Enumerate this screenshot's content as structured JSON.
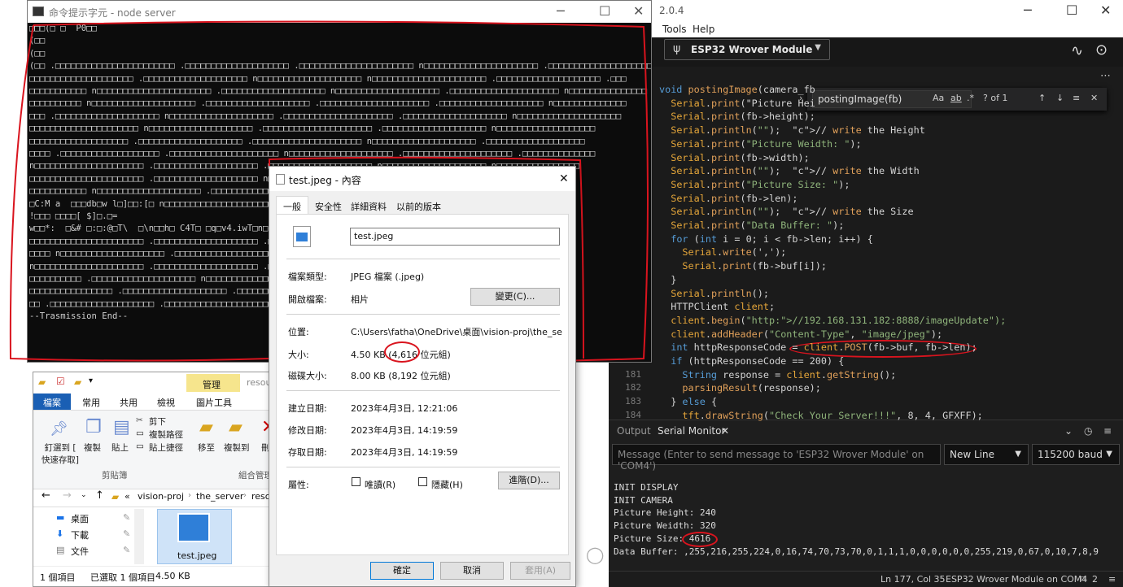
{
  "ide": {
    "title": "2.0.4",
    "menu": [
      "Tools",
      "Help"
    ],
    "board": "ESP32 Wrover Module",
    "find": {
      "query": "postingImage(fb)",
      "aa": "Aa",
      "ab": "ab",
      "star": ".*",
      "count": "? of 1"
    },
    "code": [
      "void postingImage(camera_fb",
      "  Serial.print(\"Picture Hei",
      "  Serial.print(fb->height);",
      "  Serial.println(\"\");  // write the Height",
      "  Serial.print(\"Picture Weidth: \");",
      "  Serial.print(fb->width);",
      "  Serial.println(\"\");  // write the Width",
      "  Serial.print(\"Picture Size: \");",
      "  Serial.print(fb->len);",
      "  Serial.println(\"\");  // write the Size",
      "  Serial.print(\"Data Buffer: \");",
      "  for (int i = 0; i < fb->len; i++) {",
      "    Serial.write(',');",
      "    Serial.print(fb->buf[i]);",
      "  }",
      "  Serial.println();",
      "  HTTPClient client;",
      "  client.begin(\"http://192.168.131.182:8888/imageUpdate\");",
      "  client.addHeader(\"Content-Type\", \"image/jpeg\");",
      "  int httpResponseCode = client.POST(fb->buf, fb->len);",
      "  if (httpResponseCode == 200) {",
      "    String response = client.getString();",
      "    parsingResult(response);",
      "  } else {",
      "    tft.drawString(\"Check Your Server!!!\", 8, 4, GFXFF);"
    ],
    "line_numbers": [
      "181",
      "182",
      "183",
      "184"
    ],
    "tabs": {
      "output": "Output",
      "serial": "Serial Monitor"
    },
    "message_placeholder": "Message (Enter to send message to 'ESP32 Wrover Module' on 'COM4')",
    "line_ending": "New Line",
    "baud": "115200 baud",
    "serial_lines": [
      "INIT DISPLAY",
      "INIT CAMERA",
      "Picture Height: 240",
      "Picture Weidth: 320",
      "Picture Size: 4616",
      "Data Buffer: ,255,216,255,224,0,16,74,70,73,70,0,1,1,1,0,0,0,0,0,0,255,219,0,67,0,10,7,8,9"
    ],
    "status": {
      "pos": "Ln 177, Col 35",
      "board": "ESP32 Wrover Module on COM4",
      "count": "2"
    }
  },
  "cmd": {
    "title": "命令提示字元 - node  server",
    "lines": [
      "\u0000\u0000\u0000(\u0000 \u0000  P0\u0000\u0000",
      "(\u0000\u0000",
      "(\u0000\u0000",
      "(\u0000\u0000 .\u0000\u0000\u0000\u0000\u0000\u0000\u0000\u0000\u0000\u0000\u0000\u0000\u0000\u0000\u0000\u0000\u0000\u0000\u0000\u0000\u0000\u0000\u0000 .\u0000\u0000\u0000\u0000\u0000\u0000\u0000\u0000\u0000\u0000\u0000\u0000\u0000\u0000\u0000\u0000\u0000\u0000\u0000\u0000 .\u0000\u0000\u0000\u0000\u0000\u0000\u0000\u0000\u0000\u0000\u0000\u0000\u0000\u0000\u0000\u0000\u0000\u0000\u0000\u0000\u0000\u0000 n\u0000\u0000\u0000\u0000\u0000\u0000\u0000\u0000\u0000\u0000\u0000\u0000\u0000\u0000\u0000\u0000\u0000\u0000\u0000\u0000\u0000\u0000 .\u0000\u0000\u0000\u0000\u0000\u0000\u0000\u0000\u0000\u0000\u0000\u0000\u0000\u0000\u0000\u0000\u0000\u0000\u0000\u0000",
      "\u0000\u0000\u0000\u0000\u0000\u0000\u0000\u0000\u0000\u0000\u0000\u0000\u0000\u0000\u0000\u0000\u0000\u0000\u0000\u0000 .\u0000\u0000\u0000\u0000\u0000\u0000\u0000\u0000\u0000\u0000\u0000\u0000\u0000\u0000\u0000\u0000\u0000\u0000\u0000\u0000 n\u0000\u0000\u0000\u0000\u0000\u0000\u0000\u0000\u0000\u0000\u0000\u0000\u0000\u0000\u0000\u0000\u0000\u0000\u0000\u0000 n\u0000\u0000\u0000\u0000\u0000\u0000\u0000\u0000\u0000\u0000\u0000\u0000\u0000\u0000\u0000\u0000\u0000\u0000\u0000\u0000\u0000\u0000 .\u0000\u0000\u0000\u0000\u0000\u0000\u0000\u0000\u0000\u0000\u0000\u0000\u0000\u0000\u0000\u0000\u0000\u0000\u0000\u0000 .\u0000\u0000\u0000",
      "\u0000\u0000\u0000\u0000\u0000\u0000\u0000\u0000\u0000\u0000\u0000 n\u0000\u0000\u0000\u0000\u0000\u0000\u0000\u0000\u0000\u0000\u0000\u0000\u0000\u0000\u0000\u0000\u0000\u0000\u0000\u0000\u0000\u0000 .\u0000\u0000\u0000\u0000\u0000\u0000\u0000\u0000\u0000\u0000\u0000\u0000\u0000\u0000\u0000\u0000\u0000\u0000\u0000\u0000 n\u0000\u0000\u0000\u0000\u0000\u0000\u0000\u0000\u0000\u0000\u0000\u0000\u0000\u0000\u0000\u0000\u0000\u0000\u0000\u0000 .\u0000\u0000\u0000\u0000\u0000\u0000\u0000\u0000\u0000\u0000\u0000\u0000\u0000\u0000\u0000\u0000\u0000\u0000\u0000\u0000\u0000 n\u0000\u0000\u0000\u0000\u0000\u0000\u0000\u0000\u0000\u0000\u0000\u0000\u0000\u0000\u0000",
      "\u0000\u0000\u0000\u0000\u0000\u0000\u0000\u0000\u0000\u0000 n\u0000\u0000\u0000\u0000\u0000\u0000\u0000\u0000\u0000\u0000\u0000\u0000\u0000\u0000\u0000\u0000\u0000\u0000\u0000\u0000 .\u0000\u0000\u0000\u0000\u0000\u0000\u0000\u0000\u0000\u0000\u0000\u0000\u0000\u0000\u0000\u0000\u0000\u0000\u0000\u0000 .\u0000\u0000\u0000\u0000\u0000\u0000\u0000\u0000\u0000\u0000\u0000\u0000\u0000\u0000\u0000\u0000\u0000\u0000\u0000\u0000\u0000 .\u0000\u0000\u0000\u0000\u0000\u0000\u0000\u0000\u0000\u0000\u0000\u0000\u0000\u0000\u0000\u0000\u0000\u0000\u0000\u0000 n\u0000\u0000\u0000\u0000\u0000\u0000\u0000\u0000\u0000\u0000\u0000\u0000\u0000\u0000",
      "\u0000\u0000\u0000 .\u0000\u0000\u0000\u0000\u0000\u0000\u0000\u0000\u0000\u0000\u0000\u0000\u0000\u0000\u0000\u0000\u0000\u0000\u0000\u0000 n\u0000\u0000\u0000\u0000\u0000\u0000\u0000\u0000\u0000\u0000\u0000\u0000\u0000\u0000\u0000\u0000\u0000\u0000\u0000\u0000 .\u0000\u0000\u0000\u0000\u0000\u0000\u0000\u0000\u0000\u0000\u0000\u0000\u0000\u0000\u0000\u0000\u0000\u0000\u0000\u0000\u0000 .\u0000\u0000\u0000\u0000\u0000\u0000\u0000\u0000\u0000\u0000\u0000\u0000\u0000\u0000\u0000\u0000\u0000\u0000\u0000\u0000 n\u0000\u0000\u0000\u0000\u0000\u0000\u0000\u0000\u0000\u0000\u0000\u0000\u0000\u0000\u0000\u0000\u0000\u0000\u0000\u0000",
      "\u0000\u0000\u0000\u0000\u0000\u0000\u0000\u0000\u0000\u0000\u0000\u0000\u0000\u0000\u0000\u0000\u0000\u0000\u0000\u0000\u0000 n\u0000\u0000\u0000\u0000\u0000\u0000\u0000\u0000\u0000\u0000\u0000\u0000\u0000\u0000\u0000\u0000\u0000\u0000\u0000\u0000 .\u0000\u0000\u0000\u0000\u0000\u0000\u0000\u0000\u0000\u0000\u0000\u0000\u0000\u0000\u0000\u0000\u0000\u0000\u0000\u0000\u0000 .\u0000\u0000\u0000\u0000\u0000\u0000\u0000\u0000\u0000\u0000\u0000\u0000\u0000\u0000\u0000\u0000\u0000\u0000\u0000\u0000 n\u0000\u0000\u0000\u0000\u0000\u0000\u0000\u0000\u0000\u0000\u0000\u0000\u0000\u0000\u0000\u0000\u0000\u0000\u0000",
      "\u0000\u0000\u0000\u0000\u0000\u0000\u0000\u0000\u0000\u0000\u0000\u0000\u0000\u0000\u0000\u0000\u0000\u0000\u0000 .\u0000\u0000\u0000\u0000\u0000\u0000\u0000\u0000\u0000\u0000\u0000\u0000\u0000\u0000\u0000\u0000\u0000\u0000\u0000\u0000 .\u0000\u0000\u0000\u0000\u0000\u0000\u0000\u0000\u0000\u0000\u0000\u0000\u0000\u0000\u0000\u0000\u0000\u0000\u0000\u0000\u0000 n\u0000\u0000\u0000\u0000\u0000\u0000\u0000\u0000\u0000\u0000\u0000\u0000\u0000\u0000\u0000\u0000\u0000\u0000\u0000\u0000 .\u0000\u0000\u0000\u0000\u0000\u0000\u0000\u0000\u0000\u0000\u0000\u0000\u0000\u0000\u0000\u0000\u0000\u0000\u0000",
      "\u0000\u0000\u0000\u0000 .\u0000\u0000\u0000\u0000\u0000\u0000\u0000\u0000\u0000\u0000\u0000\u0000\u0000\u0000\u0000\u0000\u0000\u0000\u0000 .\u0000\u0000\u0000\u0000\u0000\u0000\u0000\u0000\u0000\u0000\u0000\u0000\u0000\u0000\u0000\u0000\u0000\u0000\u0000\u0000\u0000 n\u0000\u0000\u0000\u0000\u0000\u0000\u0000\u0000\u0000\u0000\u0000\u0000\u0000\u0000\u0000\u0000\u0000\u0000\u0000\u0000 .\u0000\u0000\u0000\u0000\u0000\u0000\u0000\u0000\u0000\u0000\u0000\u0000\u0000\u0000\u0000\u0000\u0000\u0000\u0000\u0000\u0000 .\u0000\u0000\u0000\u0000\u0000\u0000\u0000\u0000\u0000\u0000\u0000\u0000\u0000\u0000",
      "n\u0000\u0000\u0000\u0000\u0000\u0000\u0000\u0000\u0000\u0000\u0000\u0000\u0000\u0000\u0000\u0000\u0000\u0000\u0000\u0000\u0000 .\u0000\u0000\u0000\u0000\u0000\u0000\u0000\u0000\u0000\u0000\u0000\u0000\u0000\u0000\u0000\u0000\u0000\u0000\u0000\u0000 .\u0000\u0000\u0000\u0000\u0000\u0000\u0000\u0000\u0000\u0000\u0000\u0000\u0000\u0000\u0000\u0000\u0000\u0000\u0000\u0000 n\u0000\u0000\u0000\u0000\u0000\u0000\u0000\u0000\u0000\u0000\u0000\u0000\u0000\u0000\u0000\u0000\u0000\u0000\u0000\u0000 n\u0000\u0000\u0000\u0000\u0000\u0000\u0000\u0000\u0000\u0000\u0000\u0000\u0000\u0000\u0000\u0000",
      "\u0000\u0000\u0000\u0000\u0000\u0000\u0000\u0000\u0000\u0000\u0000\u0000\u0000\u0000\u0000\u0000\u0000\u0000\u0000\u0000\u0000\u0000 .\u0000\u0000\u0000\u0000\u0000\u0000\u0000\u0000\u0000\u0000\u0000\u0000\u0000\u0000\u0000\u0000\u0000\u0000\u0000\u0000 n\u0000\u0000\u0000\u0000\u0000\u0000\u0000\u0000\u0000\u0000\u0000\u0000\u0000\u0000\u0000\u0000\u0000\u0000\u0000\u0000 .\u0000\u0000\u0000\u0000\u0000\u0000\u0000\u0000\u0000\u0000\u0000\u0000\u0000\u0000\u0000\u0000\u0000\u0000\u0000\u0000\u0000 .\u0000\u0000\u0000\u0000\u0000\u0000\u0000\u0000\u0000\u0000\u0000",
      "\u0000\u0000\u0000\u0000\u0000\u0000\u0000\u0000\u0000\u0000\u0000 n\u0000\u0000\u0000\u0000\u0000\u0000\u0000\u0000\u0000\u0000\u0000\u0000\u0000\u0000\u0000\u0000\u0000\u0000\u0000\u0000 .\u0000\u0000\u0000\u0000\u0000\u0000\u0000\u0000\u0000\u0000\u0000\u0000\u0000\u0000\u0000\u0000\u0000\u0000\u0000\u0000\u0000 n\u0000\u0000\u0000\u0000\u0000\u0000\u0000\u0000\u0000\u0000\u0000\u0000\u0000\u0000\u0000\u0000\u0000\u0000\u0000\u0000 .\u0000\u0000\u0000\u0000\u0000\u0000\u0000\u0000\u0000\u0000\u0000\u0000\u0000\u0000\u0000\u0000\u0000",
      "\u0000C:M a  \u0000\u0000\u0000db\u0000w l\u0000]\u0000\u0000:[\u0000 n\u0000\u0000\u0000\u0000\u0000\u0000\u0000\u0000\u0000\u0000\u0000\u0000\u0000\u0000\u0000\u0000\u0000\u0000\u0000\u0000\u0000\u0000\u0000\u0000\u0000\u0000\u0000\u0000\u0000\u0000\u0000\u0000\u0000\u0000\u0000\u0000\u0000\u0000\u0000\u0000\u0000\u0000\u0000\u0000\u0000\u0000\u0000\u0000\u0000\u0000\u0000\u0000\u0000\u0000\u0000\u0000\u0000\u0000\u0000\u0000\u0000\u0000\u0000\u0000\u0000\u0000\u0000\u0000\u0000\u0000]\u00006",
      "!\u0000\u0000\u0000 \u0000\u0000\u0000\u0000[ $]\u0000.\u0000=",
      "w\u0000\u0000*:  \u0000&# \u0000:\u0000:@\u0000T\\  \u0000\\n\u0000\u0000h\u0000 C4T\u0000 \u0000q\u0000v4.iwT\u0000n\u00004",
      "\u0000\u0000\u0000\u0000\u0000\u0000\u0000\u0000\u0000\u0000\u0000\u0000\u0000\u0000\u0000\u0000\u0000\u0000\u0000\u0000\u0000\u0000 .\u0000\u0000\u0000\u0000\u0000\u0000\u0000\u0000\u0000\u0000\u0000\u0000\u0000\u0000\u0000\u0000\u0000\u0000\u0000\u0000 .\u0000\u0000\u0000\u0000\u0000\u0000\u0000\u0000\u0000\u0000\u0000\u0000\u0000\u0000\u0000\u0000\u0000\u0000\u0000\u0000 n\u0000\u0000\u0000\u0000\u0000\u0000\u0000\u0000\u0000\u0000\u0000\u0000\u0000\u0000\u0000\u0000\u0000\u0000\u0000\u0000\u0000 .\u0000\u0000\u0000\u0000\u0000\u0000\u0000\u0000",
      "\u0000\u0000\u0000\u0000 n\u0000\u0000\u0000\u0000\u0000\u0000\u0000\u0000\u0000\u0000\u0000\u0000\u0000\u0000\u0000\u0000\u0000\u0000\u0000\u0000 .\u0000\u0000\u0000\u0000\u0000\u0000\u0000\u0000\u0000\u0000\u0000\u0000\u0000\u0000\u0000\u0000\u0000\u0000\u0000\u0000\u0000 n\u0000\u0000\u0000\u0000\u0000\u0000\u0000\u0000\u0000\u0000\u0000\u0000\u0000\u0000\u0000\u0000\u0000\u0000\u0000\u0000 .\u0000\u0000\u0000\u0000\u0000\u0000\u0000\u0000\u0000\u0000\u0000\u0000\u0000\u0000\u0000\u0000\u0000\u0000\u0000\u0000\u0000 .\u0000\u0000\u0000\u0000",
      "n\u0000\u0000\u0000\u0000\u0000\u0000\u0000\u0000\u0000\u0000\u0000\u0000\u0000\u0000\u0000\u0000\u0000\u0000\u0000\u0000\u0000 .\u0000\u0000\u0000\u0000\u0000\u0000\u0000\u0000\u0000\u0000\u0000\u0000\u0000\u0000\u0000\u0000\u0000\u0000\u0000\u0000 .\u0000\u0000\u0000\u0000\u0000\u0000\u0000\u0000\u0000\u0000\u0000\u0000\u0000\u0000\u0000\u0000\u0000\u0000\u0000\u0000 n\u0000\u0000\u0000\u0000\u0000\u0000\u0000\u0000\u0000\u0000\u0000\u0000\u0000\u0000\u0000\u0000\u0000\u0000\u0000\u0000 .\u0000\u0000\u0000\u0000\u0000\u0000\u0000\u0000\u0000\u0000\u0000\u0000",
      "\u0000\u0000\u0000\u0000\u0000\u0000\u0000\u0000\u0000\u0000 .\u0000\u0000\u0000\u0000\u0000\u0000\u0000\u0000\u0000\u0000\u0000\u0000\u0000\u0000\u0000\u0000\u0000\u0000\u0000\u0000 n\u0000\u0000\u0000\u0000\u0000\u0000\u0000\u0000\u0000\u0000\u0000\u0000\u0000\u0000\u0000\u0000\u0000\u0000\u0000\u0000 .\u0000\u0000\u0000\u0000\u0000\u0000\u0000\u0000\u0000\u0000\u0000\u0000\u0000\u0000\u0000\u0000\u0000\u0000\u0000\u0000\u0000 n\u0000\u0000\u0000\u0000\u0000\u0000\u0000\u0000\u0000\u0000\u0000\u0000\u0000\u0000\u0000\u0000\u0000\u0000",
      "\u0000\u0000\u0000\u0000\u0000\u0000\u0000\u0000\u0000\u0000\u0000\u0000\u0000\u0000\u0000\u0000 .\u0000\u0000\u0000\u0000\u0000\u0000\u0000\u0000\u0000\u0000\u0000\u0000\u0000\u0000\u0000\u0000\u0000\u0000\u0000\u0000 .\u0000\u0000\u0000\u0000\u0000\u0000\u0000\u0000\u0000\u0000\u0000\u0000\u0000\u0000\u0000\u0000\u0000\u0000\u0000\u0000\u0000 n\u0000\u0000\u0000\u0000\u0000\u0000\u0000\u0000\u0000\u0000\u0000\u0000\u0000\u0000\u0000\u0000\u0000\u0000\u0000\u0000 .\u0000\u0000\u0000\u0000\u0000\u0000\u0000\u0000\u0000\u0000",
      "\u0000\u0000 .\u0000\u0000\u0000\u0000\u0000\u0000\u0000\u0000\u0000\u0000\u0000\u0000\u0000\u0000\u0000\u0000\u0000\u0000\u0000\u0000 .\u0000\u0000\u0000\u0000\u0000\u0000\u0000\u0000\u0000\u0000\u0000\u0000\u0000\u0000\u0000\u0000\u0000\u0000\u0000\u0000\u0000 n\u0000\u0000\u0000\u0000\u0000\u0000\u0000\u0000\u0000\u0000\u0000\u0000\u0000\u0000\u0000\u0000\u0000\u0000\u0000\u0000 .\u0000\u0000\u0000\u0000\u0000\u0000\u0000\u0000\u0000\u0000\u0000\u0000\u0000\u0000\u0000\u0000\u0000\u0000\u0000\u0000",
      "--Trasmission End--"
    ]
  },
  "explorer": {
    "ribbon_tab_manage": "管理",
    "ribbon_tab_manage_sub": "圖片工具",
    "title_fragment": "resou",
    "tabs": [
      "檔案",
      "常用",
      "共用",
      "檢視"
    ],
    "ribbon": {
      "pin": "釘選到 [\n快速存取]",
      "copy": "複製",
      "paste": "貼上",
      "cut": "剪下",
      "copy_path": "複製路徑",
      "paste_shortcut": "貼上捷徑",
      "move_to": "移至",
      "copy_to": "複製到",
      "delete": "刪",
      "group_clipboard": "剪貼簿",
      "group_organize": "組合管理"
    },
    "address": [
      "«",
      "vision-proj",
      "the_server",
      "reso"
    ],
    "nav_items": [
      "桌面",
      "下載",
      "文件"
    ],
    "file": "test.jpeg",
    "status": {
      "count": "1 個項目",
      "selected": "已選取 1 個項目",
      "size": "4.50 KB"
    }
  },
  "dialog": {
    "title": "test.jpeg - 內容",
    "tabs": [
      "一般",
      "安全性",
      "詳細資料",
      "以前的版本"
    ],
    "filename": "test.jpeg",
    "rows": [
      {
        "label": "檔案類型:",
        "value": "JPEG 檔案 (.jpeg)"
      },
      {
        "label": "開啟檔案:",
        "value": "相片"
      },
      {
        "label": "位置:",
        "value": "C:\\Users\\fatha\\OneDrive\\桌面\\vision-proj\\the_server\\"
      },
      {
        "label": "大小:",
        "value": "4.50 KB (4,616 位元組)"
      },
      {
        "label": "磁碟大小:",
        "value": "8.00 KB (8,192 位元組)"
      },
      {
        "label": "建立日期:",
        "value": "2023年4月3日, 12:21:06"
      },
      {
        "label": "修改日期:",
        "value": "2023年4月3日, 14:19:59"
      },
      {
        "label": "存取日期:",
        "value": "2023年4月3日, 14:19:59"
      }
    ],
    "change_button": "變更(C)...",
    "attributes_label": "屬性:",
    "readonly": "唯讀(R)",
    "hidden": "隱藏(H)",
    "advanced": "進階(D)...",
    "ok": "確定",
    "cancel": "取消",
    "apply": "套用(A)"
  }
}
